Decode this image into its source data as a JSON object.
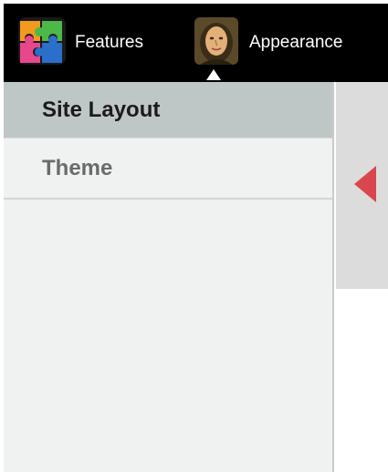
{
  "toolbar": {
    "tabs": [
      {
        "label": "Features",
        "icon": "puzzle-icon",
        "selected": false
      },
      {
        "label": "Appearance",
        "icon": "portrait-icon",
        "selected": true
      }
    ]
  },
  "sidebar": {
    "items": [
      {
        "label": "Site Layout",
        "active": true
      },
      {
        "label": "Theme",
        "active": false
      }
    ]
  },
  "colors": {
    "toolbar_bg": "#000000",
    "sidebar_bg": "#f0f2f1",
    "active_item_bg": "#bfc7c6",
    "handle_bg": "#dcdcdc",
    "arrow": "#d9464d"
  },
  "collapse_handle": {
    "icon": "collapse-left-icon"
  }
}
